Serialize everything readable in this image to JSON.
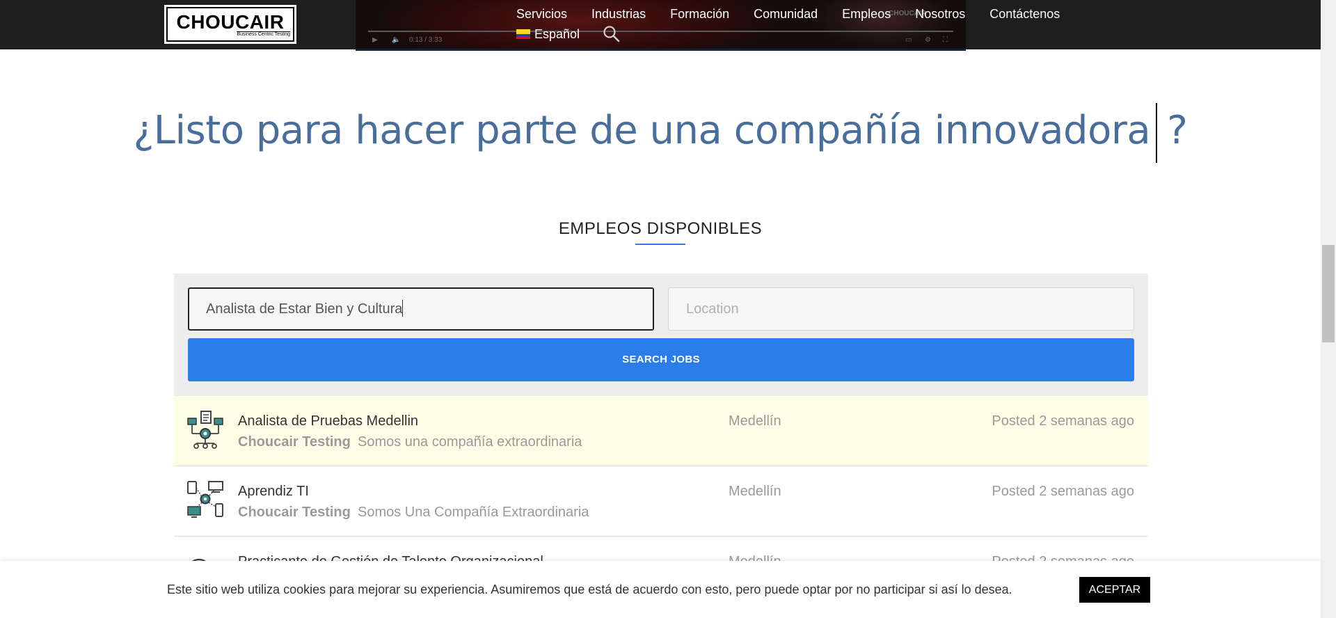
{
  "header": {
    "logo": {
      "name": "CHOUCAIR",
      "tagline": "Business Centric Testing"
    },
    "nav": [
      "Servicios",
      "Industrias",
      "Formación",
      "Comunidad",
      "Empleos",
      "Nosotros",
      "Contáctenos"
    ],
    "language": "Español",
    "video": {
      "time": "0:13 / 3:33",
      "watermark": "CHOUCAIR"
    }
  },
  "hero": {
    "headline": "¿Listo para hacer parte de una compañía innovadora",
    "question_mark": "?"
  },
  "jobs_section": {
    "title": "EMPLEOS DISPONIBLES",
    "keyword_value": "Analista de Estar Bien y Cultura",
    "location_placeholder": "Location",
    "search_button": "SEARCH JOBS",
    "jobs": [
      {
        "title": "Analista de Pruebas Medellin",
        "company": "Choucair Testing",
        "tagline": "Somos una compañía extraordinaria",
        "location": "Medellín",
        "posted": "Posted 2 semanas ago",
        "featured": true,
        "icon": "workflow-icon"
      },
      {
        "title": "Aprendiz TI",
        "company": "Choucair Testing",
        "tagline": "Somos Una Compañía Extraordinaria",
        "location": "Medellín",
        "posted": "Posted 2 semanas ago",
        "featured": false,
        "icon": "devices-network-icon"
      },
      {
        "title": "Practicante de Gestión de Talento Organizacional",
        "company": "",
        "tagline": "",
        "location": "Medellín",
        "posted": "Posted 2 semanas ago",
        "featured": false,
        "icon": "talent-icon"
      }
    ]
  },
  "cookie": {
    "text": "Este sitio web utiliza cookies para mejorar su experiencia. Asumiremos que está de acuerdo con esto, pero puede optar por no participar si así lo desea.",
    "accept": "ACEPTAR"
  },
  "colors": {
    "header_bg": "#1e1e1e",
    "accent_blue": "#2b7de9",
    "headline_blue": "#4a6e9c",
    "featured_bg": "#fefee6"
  }
}
